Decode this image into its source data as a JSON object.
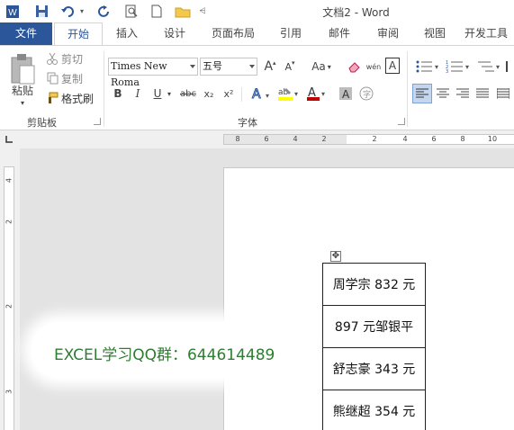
{
  "window": {
    "title": "文档2 - Word"
  },
  "tabs": [
    "文件",
    "开始",
    "插入",
    "设计",
    "页面布局",
    "引用",
    "邮件",
    "审阅",
    "视图",
    "开发工具"
  ],
  "clipboard": {
    "paste": "粘贴",
    "cut": "剪切",
    "copy": "复制",
    "format_painter": "格式刷",
    "group_label": "剪贴板"
  },
  "font": {
    "family": "Times New Roma",
    "size": "五号",
    "group_label": "字体",
    "bold": "B",
    "italic": "I",
    "underline": "U",
    "strike": "abc",
    "subscript": "x₂",
    "superscript": "x²",
    "change_case": "Aa",
    "grow": "A",
    "shrink": "A",
    "phonetic": "wén",
    "charborder": "A",
    "color_accent": "#c00000",
    "highlight_accent": "#ffff00"
  },
  "ruler": {
    "h": [
      "8",
      "6",
      "4",
      "2",
      "2",
      "4",
      "6",
      "8",
      "10"
    ],
    "v": [
      "4",
      "2",
      "2",
      "3"
    ]
  },
  "document": {
    "cells": [
      "周学宗 832 元",
      "897 元邹银平",
      "舒志豪 343 元",
      "熊继超 354 元"
    ]
  },
  "watermark": "EXCEL学习QQ群：644614489",
  "colors": {
    "accent": "#2b579a",
    "watermark": "#2e7d32"
  }
}
